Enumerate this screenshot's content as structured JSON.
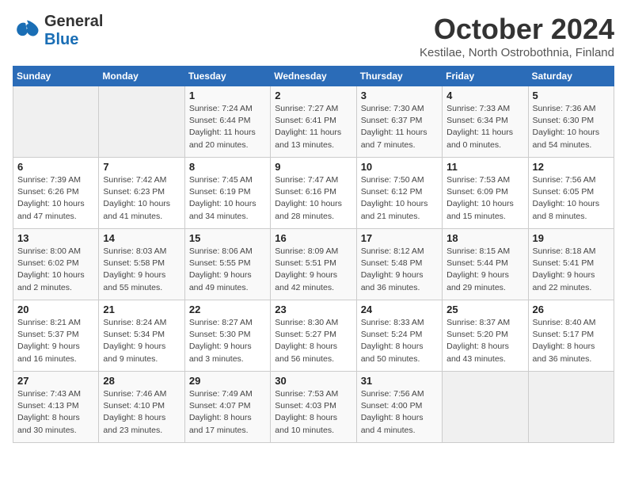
{
  "header": {
    "logo_general": "General",
    "logo_blue": "Blue",
    "title": "October 2024",
    "subtitle": "Kestilae, North Ostrobothnia, Finland"
  },
  "weekdays": [
    "Sunday",
    "Monday",
    "Tuesday",
    "Wednesday",
    "Thursday",
    "Friday",
    "Saturday"
  ],
  "weeks": [
    [
      {
        "day": "",
        "info": ""
      },
      {
        "day": "",
        "info": ""
      },
      {
        "day": "1",
        "info": "Sunrise: 7:24 AM\nSunset: 6:44 PM\nDaylight: 11 hours\nand 20 minutes."
      },
      {
        "day": "2",
        "info": "Sunrise: 7:27 AM\nSunset: 6:41 PM\nDaylight: 11 hours\nand 13 minutes."
      },
      {
        "day": "3",
        "info": "Sunrise: 7:30 AM\nSunset: 6:37 PM\nDaylight: 11 hours\nand 7 minutes."
      },
      {
        "day": "4",
        "info": "Sunrise: 7:33 AM\nSunset: 6:34 PM\nDaylight: 11 hours\nand 0 minutes."
      },
      {
        "day": "5",
        "info": "Sunrise: 7:36 AM\nSunset: 6:30 PM\nDaylight: 10 hours\nand 54 minutes."
      }
    ],
    [
      {
        "day": "6",
        "info": "Sunrise: 7:39 AM\nSunset: 6:26 PM\nDaylight: 10 hours\nand 47 minutes."
      },
      {
        "day": "7",
        "info": "Sunrise: 7:42 AM\nSunset: 6:23 PM\nDaylight: 10 hours\nand 41 minutes."
      },
      {
        "day": "8",
        "info": "Sunrise: 7:45 AM\nSunset: 6:19 PM\nDaylight: 10 hours\nand 34 minutes."
      },
      {
        "day": "9",
        "info": "Sunrise: 7:47 AM\nSunset: 6:16 PM\nDaylight: 10 hours\nand 28 minutes."
      },
      {
        "day": "10",
        "info": "Sunrise: 7:50 AM\nSunset: 6:12 PM\nDaylight: 10 hours\nand 21 minutes."
      },
      {
        "day": "11",
        "info": "Sunrise: 7:53 AM\nSunset: 6:09 PM\nDaylight: 10 hours\nand 15 minutes."
      },
      {
        "day": "12",
        "info": "Sunrise: 7:56 AM\nSunset: 6:05 PM\nDaylight: 10 hours\nand 8 minutes."
      }
    ],
    [
      {
        "day": "13",
        "info": "Sunrise: 8:00 AM\nSunset: 6:02 PM\nDaylight: 10 hours\nand 2 minutes."
      },
      {
        "day": "14",
        "info": "Sunrise: 8:03 AM\nSunset: 5:58 PM\nDaylight: 9 hours\nand 55 minutes."
      },
      {
        "day": "15",
        "info": "Sunrise: 8:06 AM\nSunset: 5:55 PM\nDaylight: 9 hours\nand 49 minutes."
      },
      {
        "day": "16",
        "info": "Sunrise: 8:09 AM\nSunset: 5:51 PM\nDaylight: 9 hours\nand 42 minutes."
      },
      {
        "day": "17",
        "info": "Sunrise: 8:12 AM\nSunset: 5:48 PM\nDaylight: 9 hours\nand 36 minutes."
      },
      {
        "day": "18",
        "info": "Sunrise: 8:15 AM\nSunset: 5:44 PM\nDaylight: 9 hours\nand 29 minutes."
      },
      {
        "day": "19",
        "info": "Sunrise: 8:18 AM\nSunset: 5:41 PM\nDaylight: 9 hours\nand 22 minutes."
      }
    ],
    [
      {
        "day": "20",
        "info": "Sunrise: 8:21 AM\nSunset: 5:37 PM\nDaylight: 9 hours\nand 16 minutes."
      },
      {
        "day": "21",
        "info": "Sunrise: 8:24 AM\nSunset: 5:34 PM\nDaylight: 9 hours\nand 9 minutes."
      },
      {
        "day": "22",
        "info": "Sunrise: 8:27 AM\nSunset: 5:30 PM\nDaylight: 9 hours\nand 3 minutes."
      },
      {
        "day": "23",
        "info": "Sunrise: 8:30 AM\nSunset: 5:27 PM\nDaylight: 8 hours\nand 56 minutes."
      },
      {
        "day": "24",
        "info": "Sunrise: 8:33 AM\nSunset: 5:24 PM\nDaylight: 8 hours\nand 50 minutes."
      },
      {
        "day": "25",
        "info": "Sunrise: 8:37 AM\nSunset: 5:20 PM\nDaylight: 8 hours\nand 43 minutes."
      },
      {
        "day": "26",
        "info": "Sunrise: 8:40 AM\nSunset: 5:17 PM\nDaylight: 8 hours\nand 36 minutes."
      }
    ],
    [
      {
        "day": "27",
        "info": "Sunrise: 7:43 AM\nSunset: 4:13 PM\nDaylight: 8 hours\nand 30 minutes."
      },
      {
        "day": "28",
        "info": "Sunrise: 7:46 AM\nSunset: 4:10 PM\nDaylight: 8 hours\nand 23 minutes."
      },
      {
        "day": "29",
        "info": "Sunrise: 7:49 AM\nSunset: 4:07 PM\nDaylight: 8 hours\nand 17 minutes."
      },
      {
        "day": "30",
        "info": "Sunrise: 7:53 AM\nSunset: 4:03 PM\nDaylight: 8 hours\nand 10 minutes."
      },
      {
        "day": "31",
        "info": "Sunrise: 7:56 AM\nSunset: 4:00 PM\nDaylight: 8 hours\nand 4 minutes."
      },
      {
        "day": "",
        "info": ""
      },
      {
        "day": "",
        "info": ""
      }
    ]
  ]
}
